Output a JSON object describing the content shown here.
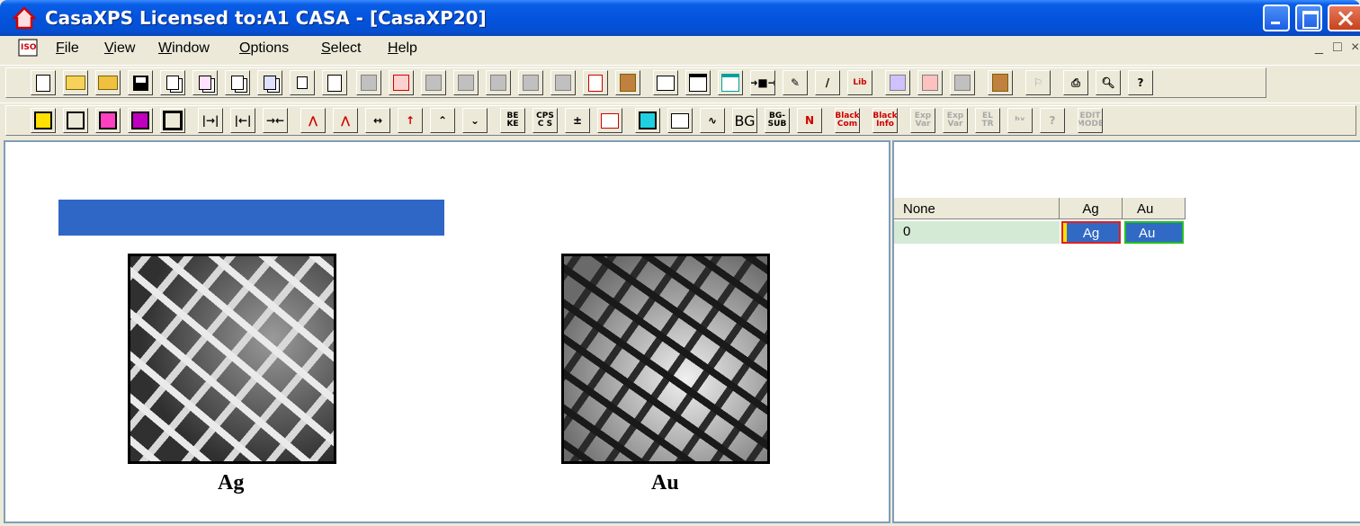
{
  "window": {
    "title": "CasaXPS Licensed to:A1 CASA - [CasaXP20]"
  },
  "menu": {
    "items": [
      "File",
      "View",
      "Window",
      "Options",
      "Select",
      "Help"
    ],
    "mdi_controls": [
      "_",
      "□",
      "×"
    ]
  },
  "toolbar2_labels": {
    "be_ke": "BE KE",
    "cps_cs": "CPS C S",
    "bg": "BG",
    "bg_sub": "BG- SUB",
    "black_com": "Black Com",
    "black_info": "Black Info",
    "exp_var": "Exp Var",
    "exp_var2": "Exp Var",
    "el_tr": "EL TR",
    "edit_mode": "EDIT MODE"
  },
  "images": [
    {
      "label": "Ag"
    },
    {
      "label": "Au"
    }
  ],
  "table": {
    "headers": [
      "None",
      "Ag",
      "Au"
    ],
    "rows": [
      {
        "none": "0",
        "ag": "Ag",
        "au": "Au"
      }
    ]
  },
  "colors": {
    "title_bar": "#0453dc",
    "header_banner": "#2f67c6",
    "row_highlight": "#d4ead4",
    "cell_selected": "#316ac5",
    "ag_border": "#e02020",
    "au_border": "#20c020"
  }
}
